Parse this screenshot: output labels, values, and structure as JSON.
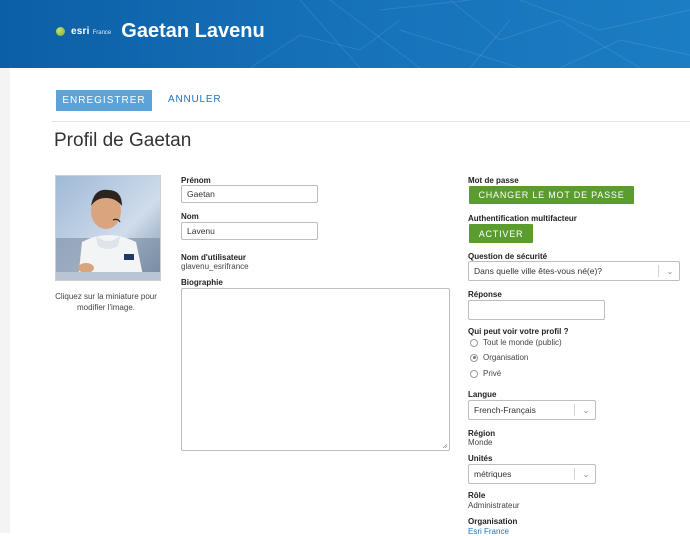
{
  "header": {
    "brand_name": "esri",
    "brand_sub": "France",
    "owner_name": "Gaetan Lavenu",
    "colors": {
      "banner": "#1670b8",
      "accent_blue": "#5ba3d9",
      "accent_green": "#5b9c2f"
    }
  },
  "actions": {
    "save_label": "ENREGISTRER",
    "cancel_label": "ANNULER"
  },
  "page": {
    "title": "Profil de Gaetan"
  },
  "avatar": {
    "caption": "Cliquez sur la miniature pour modifier l'image."
  },
  "left_form": {
    "first_name_label": "Prénom",
    "first_name_value": "Gaetan",
    "last_name_label": "Nom",
    "last_name_value": "Lavenu",
    "username_label": "Nom d'utilisateur",
    "username_value": "glavenu_esrifrance",
    "bio_label": "Biographie",
    "bio_value": ""
  },
  "right_form": {
    "password_label": "Mot de passe",
    "change_password_button": "CHANGER LE MOT DE PASSE",
    "mfa_label": "Authentification multifacteur",
    "activate_button": "ACTIVER",
    "security_question_label": "Question de sécurité",
    "security_question_value": "Dans quelle ville êtes-vous né(e)?",
    "answer_label": "Réponse",
    "answer_value": "",
    "visibility_label": "Qui peut voir votre profil ?",
    "visibility_options": [
      "Tout le monde (public)",
      "Organisation",
      "Privé"
    ],
    "visibility_selected": "Organisation",
    "language_label": "Langue",
    "language_value": "French-Français",
    "region_label": "Région",
    "region_value": "Monde",
    "units_label": "Unités",
    "units_value": "métriques",
    "role_label": "Rôle",
    "role_value": "Administrateur",
    "organization_label": "Organisation",
    "organization_value": "Esri France"
  }
}
